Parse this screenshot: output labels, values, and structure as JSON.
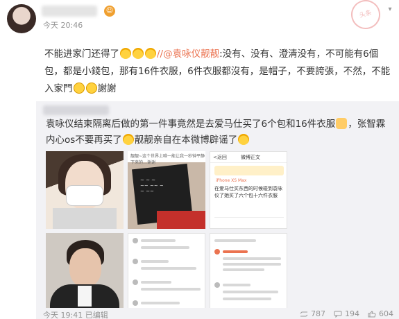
{
  "post": {
    "time": "今天 20:46",
    "text_prefix": "不能进家门还得了",
    "mention": "//@袁咏仪靓靓",
    "text_body": ":没有、没有、澄清没有，不可能有6個包，都是小錢包，那有16件衣服，6件衣服都沒有，是帽子，不要誇張，不然，不能入家門",
    "text_suffix": "謝謝",
    "stamp_text": "头条"
  },
  "repost": {
    "text_a": "袁咏仪结束隔离后做的第一件事竟然是去爱马仕买了6个包和16件衣服",
    "text_b": "，张智霖内心os不要再买了",
    "text_c": "靓靓亲自在本微博辟谣了",
    "thumb2_caption": "靓靓~这个世界上唯一能让我一秒钟平静下来的…谢谢",
    "thumb3": {
      "back": "<返回",
      "title": "微博正文",
      "body": "在爱马仕买东西的时候碰到袁咏仪了她买了六个包十六件衣服",
      "device": "iPhone XS Max"
    },
    "footer_time": "今天 19:41",
    "footer_edit": "已编辑",
    "reposts": "787",
    "comments": "194",
    "likes": "604"
  }
}
